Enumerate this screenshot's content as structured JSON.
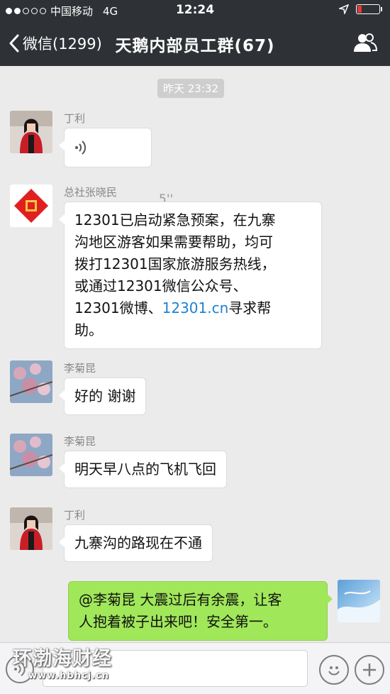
{
  "status_bar": {
    "carrier": "中国移动",
    "network": "4G",
    "time": "12:24",
    "battery_level": 0.2
  },
  "nav": {
    "back_label": "微信(1299)",
    "title": "天鹅内部员工群(67)"
  },
  "chat": {
    "timestamp": "昨天 23:32",
    "messages": [
      {
        "sender": "丁利",
        "type": "voice",
        "duration": "5''"
      },
      {
        "sender": "总社张晓民",
        "type": "text",
        "text_lines": [
          "12301已启动紧急预案，在九寨",
          "沟地区游客如果需要帮助，均可",
          "拨打12301国家旅游服务热线，",
          "或通过12301微信公众号、"
        ],
        "text_last_prefix": "12301微博、",
        "link": "12301.cn",
        "text_last_suffix": "寻求帮",
        "text_tail": "助。"
      },
      {
        "sender": "李菊昆",
        "type": "text",
        "text": "好的 谢谢"
      },
      {
        "sender": "李菊昆",
        "type": "text",
        "text": "明天早八点的飞机飞回"
      },
      {
        "sender": "丁利",
        "type": "text",
        "text": "九寨沟的路现在不通"
      },
      {
        "sender": "self",
        "type": "text",
        "text_lines": [
          "@李菊昆 大震过后有余震，让客",
          "人抱着被子出来吧！安全第一。"
        ]
      }
    ]
  },
  "watermark": {
    "title": "环渤海财经",
    "url": "www.hbhcj.cn"
  },
  "colors": {
    "header_bg": "#2e3135",
    "self_bubble": "#a0e75a",
    "link": "#1f82d2"
  }
}
